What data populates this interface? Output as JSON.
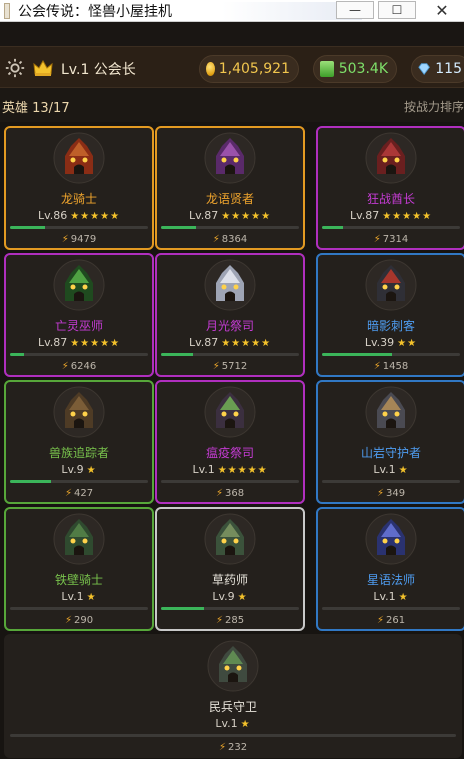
{
  "window": {
    "title": "公会传说：怪兽小屋挂机",
    "minimize_label": "—",
    "maximize_label": "☐",
    "close_label": "✕"
  },
  "topbar": {
    "rank": "Lv.1 公会长",
    "gold": "1,405,921",
    "green": "503.4K",
    "diamond": "115",
    "icons": [
      "gear-icon",
      "crown-icon",
      "coin-icon",
      "green-gem-icon",
      "diamond-icon"
    ]
  },
  "heroes_header": {
    "count": "英雄 13/17",
    "sort": "按战力排序"
  },
  "colors": {
    "orange": "#e39a22",
    "purple": "#b02fbf",
    "blue": "#3178c4",
    "green": "#57a73a",
    "white": "#c9c9c9",
    "name_orange": "#f0a52d",
    "name_purple": "#c43bd3",
    "name_blue": "#4e9cf0",
    "name_green": "#78c24c",
    "name_white": "#e7e3da",
    "bar_fill": "#3bb55a",
    "star": "#f4c22b"
  },
  "heroes": [
    {
      "name": "龙骑士",
      "level": "Lv.86",
      "stars": "★★★★★",
      "power": "9479",
      "exp": 0.25,
      "rarity": "orange",
      "portrait": "red-dragon-house"
    },
    {
      "name": "龙语贤者",
      "level": "Lv.87",
      "stars": "★★★★★",
      "power": "8364",
      "exp": 0.25,
      "rarity": "orange",
      "portrait": "purple-sage-house"
    },
    {
      "name": "狂战酋长",
      "level": "Lv.87",
      "stars": "★★★★★",
      "power": "7314",
      "exp": 0.15,
      "rarity": "purple",
      "portrait": "red-orc-house"
    },
    {
      "name": "亡灵巫师",
      "level": "Lv.87",
      "stars": "★★★★★",
      "power": "6246",
      "exp": 0.1,
      "rarity": "purple",
      "portrait": "green-skull-house"
    },
    {
      "name": "月光祭司",
      "level": "Lv.87",
      "stars": "★★★★★",
      "power": "5712",
      "exp": 0.23,
      "rarity": "purple",
      "portrait": "white-crystal-house"
    },
    {
      "name": "暗影刺客",
      "level": "Lv.39",
      "stars": "★★",
      "power": "1458",
      "exp": 0.51,
      "rarity": "blue",
      "portrait": "dark-red-eye-house"
    },
    {
      "name": "兽族追踪者",
      "level": "Lv.9",
      "stars": "★",
      "power": "427",
      "exp": 0.3,
      "rarity": "green",
      "portrait": "wood-stump-house"
    },
    {
      "name": "瘟疫祭司",
      "level": "Lv.1",
      "stars": "★★★★★",
      "power": "368",
      "exp": 0.0,
      "rarity": "purple",
      "portrait": "green-glow-house"
    },
    {
      "name": "山岩守护者",
      "level": "Lv.1",
      "stars": "★",
      "power": "349",
      "exp": 0.0,
      "rarity": "blue",
      "portrait": "stone-tower-house"
    },
    {
      "name": "铁壁骑士",
      "level": "Lv.1",
      "stars": "★",
      "power": "290",
      "exp": 0.0,
      "rarity": "green",
      "portrait": "green-knight-house"
    },
    {
      "name": "草药师",
      "level": "Lv.9",
      "stars": "★",
      "power": "285",
      "exp": 0.31,
      "rarity": "white",
      "portrait": "herb-house"
    },
    {
      "name": "星语法师",
      "level": "Lv.1",
      "stars": "★",
      "power": "261",
      "exp": 0.0,
      "rarity": "blue",
      "portrait": "blue-star-house"
    },
    {
      "name": "民兵守卫",
      "level": "Lv.1",
      "stars": "★",
      "power": "232",
      "exp": 0.0,
      "rarity": "white",
      "portrait": "green-guard-house"
    }
  ]
}
